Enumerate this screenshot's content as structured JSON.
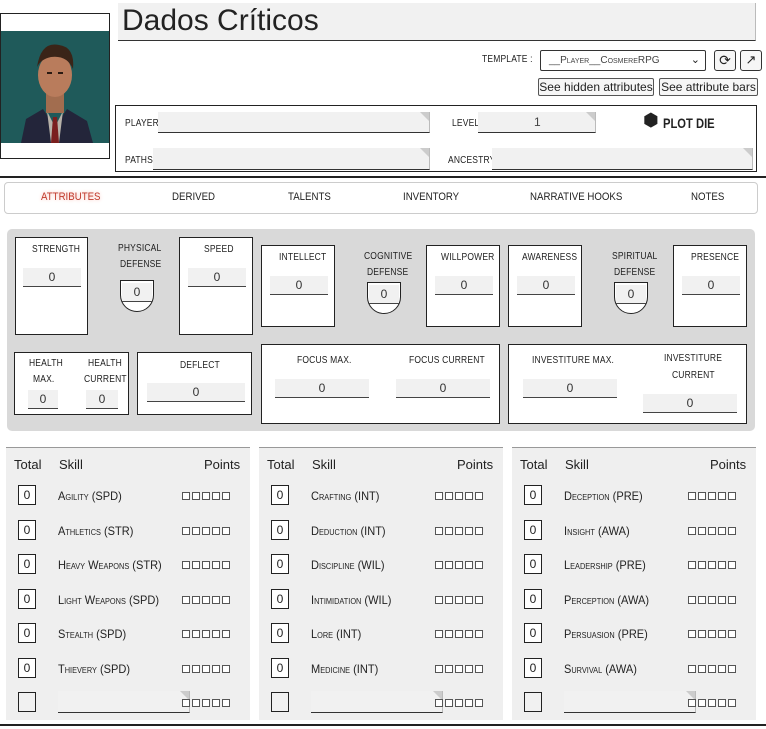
{
  "header": {
    "title": "Dados Críticos",
    "template_label": "TEMPLATE :",
    "template_value": "__Player__CosmereRPG",
    "hidden_attrs_btn": "See hidden attributes",
    "attr_bars_btn": "See attribute bars"
  },
  "info": {
    "player_label": "PLAYER",
    "level_label": "LEVEL",
    "level_value": "1",
    "plot_die": "PLOT DIE",
    "paths_label": "PATHS",
    "ancestry_label": "ANCESTRY"
  },
  "tabs": [
    "ATTRIBUTES",
    "DERIVED",
    "TALENTS",
    "INVENTORY",
    "NARRATIVE HOOKS",
    "NOTES"
  ],
  "attributes": {
    "strength": {
      "label": "STRENGTH",
      "value": "0"
    },
    "physical_defense": {
      "label1": "PHYSICAL",
      "label2": "DEFENSE",
      "value": "0"
    },
    "speed": {
      "label": "SPEED",
      "value": "0"
    },
    "intellect": {
      "label": "INTELLECT",
      "value": "0"
    },
    "cognitive_defense": {
      "label1": "COGNITIVE",
      "label2": "DEFENSE",
      "value": "0"
    },
    "willpower": {
      "label": "WILLPOWER",
      "value": "0"
    },
    "awareness": {
      "label": "AWARENESS",
      "value": "0"
    },
    "spiritual_defense": {
      "label1": "SPIRITUAL",
      "label2": "DEFENSE",
      "value": "0"
    },
    "presence": {
      "label": "PRESENCE",
      "value": "0"
    },
    "health_max": {
      "label1": "HEALTH",
      "label2": "MAX.",
      "value": "0"
    },
    "health_current": {
      "label1": "HEALTH",
      "label2": "CURRENT",
      "value": "0"
    },
    "deflect": {
      "label": "DEFLECT",
      "value": "0"
    },
    "focus_max": {
      "label": "FOCUS MAX.",
      "value": "0"
    },
    "focus_current": {
      "label": "FOCUS CURRENT",
      "value": "0"
    },
    "investiture_max": {
      "label": "INVESTITURE MAX.",
      "value": "0"
    },
    "investiture_current": {
      "label1": "INVESTITURE",
      "label2": "CURRENT",
      "value": "0"
    }
  },
  "skills_header": {
    "total": "Total",
    "skill": "Skill",
    "points": "Points"
  },
  "skills": [
    [
      {
        "name": "Agility (SPD)",
        "total": "0"
      },
      {
        "name": "Athletics (STR)",
        "total": "0"
      },
      {
        "name": "Heavy Weapons (STR)",
        "total": "0"
      },
      {
        "name": "Light Weapons (SPD)",
        "total": "0"
      },
      {
        "name": "Stealth (SPD)",
        "total": "0"
      },
      {
        "name": "Thievery (SPD)",
        "total": "0"
      }
    ],
    [
      {
        "name": "Crafting (INT)",
        "total": "0"
      },
      {
        "name": "Deduction (INT)",
        "total": "0"
      },
      {
        "name": "Discipline (WIL)",
        "total": "0"
      },
      {
        "name": "Intimidation (WIL)",
        "total": "0"
      },
      {
        "name": "Lore (INT)",
        "total": "0"
      },
      {
        "name": "Medicine (INT)",
        "total": "0"
      }
    ],
    [
      {
        "name": "Deception (PRE)",
        "total": "0"
      },
      {
        "name": "Insight (AWA)",
        "total": "0"
      },
      {
        "name": "Leadership (PRE)",
        "total": "0"
      },
      {
        "name": "Perception (AWA)",
        "total": "0"
      },
      {
        "name": "Persuasion (PRE)",
        "total": "0"
      },
      {
        "name": "Survival (AWA)",
        "total": "0"
      }
    ]
  ],
  "colors": {
    "active_tab": "#c0392b",
    "panel": "#d9d9d9"
  }
}
